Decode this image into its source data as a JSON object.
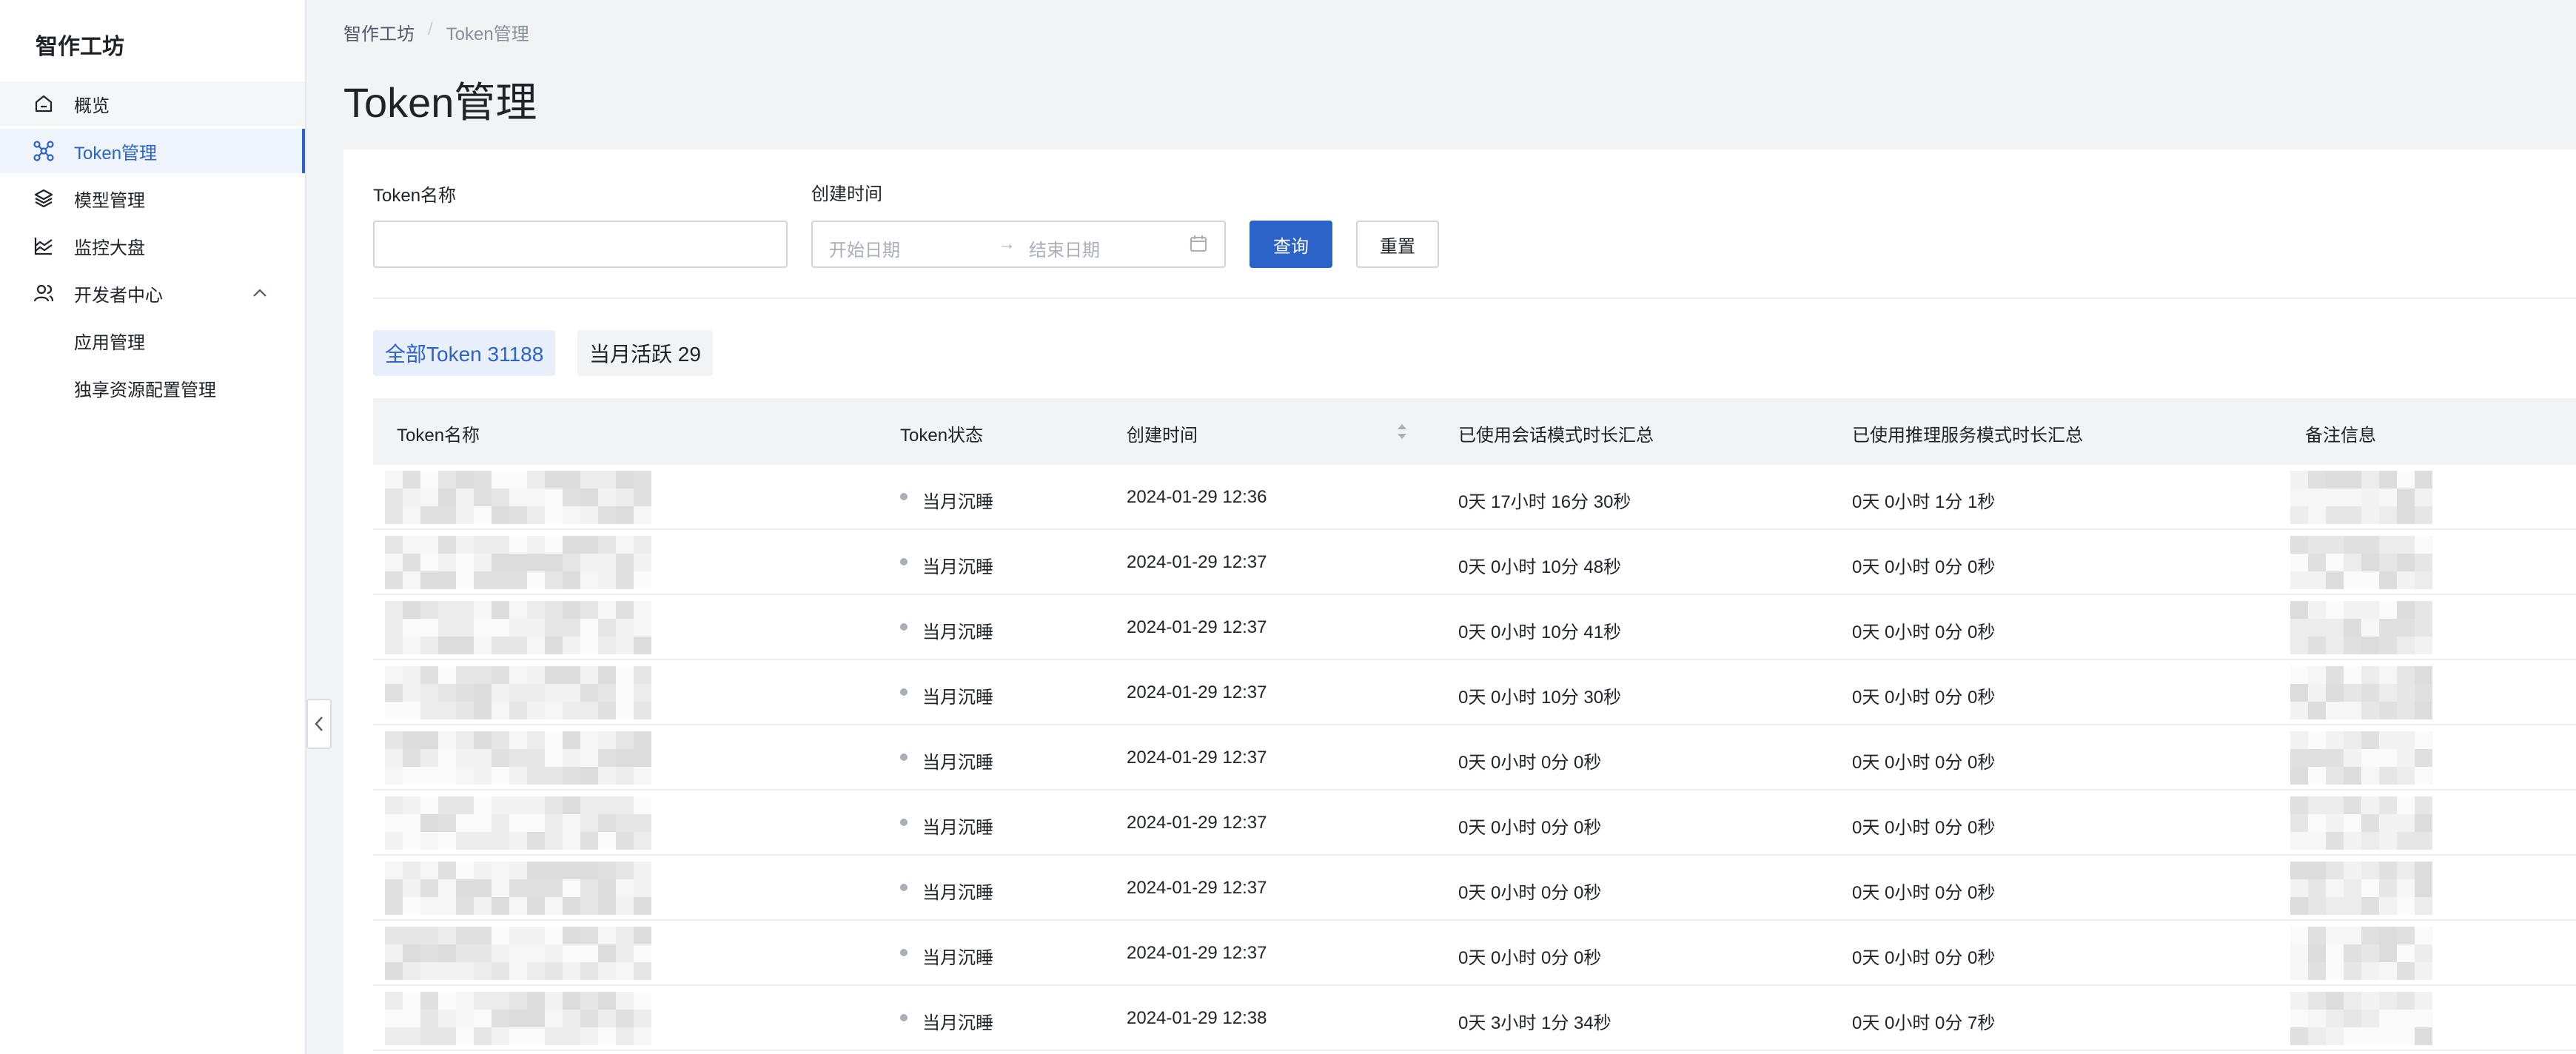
{
  "sidebar": {
    "brand": "智作工坊",
    "items": [
      {
        "label": "概览",
        "icon": "home-icon"
      },
      {
        "label": "Token管理",
        "icon": "network-icon"
      },
      {
        "label": "模型管理",
        "icon": "layers-icon"
      },
      {
        "label": "监控大盘",
        "icon": "chart-area-icon"
      },
      {
        "label": "开发者中心",
        "icon": "user-group-icon"
      }
    ],
    "sub_items": [
      {
        "label": "应用管理"
      },
      {
        "label": "独享资源配置管理"
      }
    ]
  },
  "breadcrumb": {
    "root": "智作工坊",
    "separator": "/",
    "current": "Token管理"
  },
  "page_title": "Token管理",
  "filters": {
    "name_label": "Token名称",
    "time_label": "创建时间",
    "start_placeholder": "开始日期",
    "arrow": "→",
    "end_placeholder": "结束日期",
    "query_button": "查询",
    "reset_button": "重置"
  },
  "tabs": {
    "all": "全部Token 31188",
    "active": "当月活跃 29"
  },
  "table": {
    "columns": [
      "Token名称",
      "Token状态",
      "创建时间",
      "已使用会话模式时长汇总",
      "已使用推理服务模式时长汇总",
      "备注信息"
    ],
    "rows": [
      {
        "status": "当月沉睡",
        "created": "2024-01-29 12:36",
        "session": "0天 17小时 16分 30秒",
        "inference": "0天 0小时 1分 1秒"
      },
      {
        "status": "当月沉睡",
        "created": "2024-01-29 12:37",
        "session": "0天 0小时 10分 48秒",
        "inference": "0天 0小时 0分 0秒"
      },
      {
        "status": "当月沉睡",
        "created": "2024-01-29 12:37",
        "session": "0天 0小时 10分 41秒",
        "inference": "0天 0小时 0分 0秒"
      },
      {
        "status": "当月沉睡",
        "created": "2024-01-29 12:37",
        "session": "0天 0小时 10分 30秒",
        "inference": "0天 0小时 0分 0秒"
      },
      {
        "status": "当月沉睡",
        "created": "2024-01-29 12:37",
        "session": "0天 0小时 0分 0秒",
        "inference": "0天 0小时 0分 0秒"
      },
      {
        "status": "当月沉睡",
        "created": "2024-01-29 12:37",
        "session": "0天 0小时 0分 0秒",
        "inference": "0天 0小时 0分 0秒"
      },
      {
        "status": "当月沉睡",
        "created": "2024-01-29 12:37",
        "session": "0天 0小时 0分 0秒",
        "inference": "0天 0小时 0分 0秒"
      },
      {
        "status": "当月沉睡",
        "created": "2024-01-29 12:37",
        "session": "0天 0小时 0分 0秒",
        "inference": "0天 0小时 0分 0秒"
      },
      {
        "status": "当月沉睡",
        "created": "2024-01-29 12:38",
        "session": "0天 3小时 1分 34秒",
        "inference": "0天 0小时 0分 7秒"
      }
    ]
  },
  "colors": {
    "accent": "#2b63c8",
    "status_dot": "#a9aeb8"
  }
}
